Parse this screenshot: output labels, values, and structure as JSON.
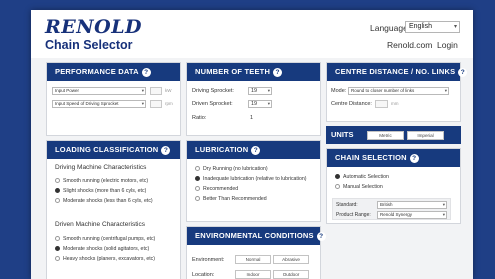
{
  "header": {
    "logo_text": "RENOLD",
    "app_title": "Chain Selector",
    "language_label": "Language",
    "language_value": "English",
    "site_link": "Renold.com",
    "login_link": "Login"
  },
  "performance": {
    "title": "PERFORMANCE DATA",
    "info_icon": "?",
    "input_power": {
      "value": "Input Power",
      "unit": "kW"
    },
    "input_speed": {
      "value": "Input Speed of Driving Sprocket",
      "unit": "rpm"
    }
  },
  "teeth": {
    "title": "NUMBER OF TEETH",
    "info_icon": "?",
    "driving_label": "Driving Sprocket:",
    "driving_value": "19",
    "driven_label": "Driven Sprocket:",
    "driven_value": "19",
    "ratio_label": "Ratio:",
    "ratio_value": "1"
  },
  "centre": {
    "title": "CENTRE DISTANCE / NO. LINKS",
    "info_icon": "?",
    "mode_label": "Mode:",
    "mode_value": "Round to closer number of links",
    "distance_label": "Centre Distance:",
    "distance_unit": "mm"
  },
  "units": {
    "title": "UNITS",
    "metric": "Metric",
    "imperial": "Imperial"
  },
  "loading": {
    "title": "LOADING CLASSIFICATION",
    "info_icon": "?",
    "driving_heading": "Driving Machine Characteristics",
    "driving_options": [
      "Smooth running (electric motors, etc)",
      "Slight shocks (more than 6 cyls, etc)",
      "Moderate shocks (less than 6 cyls, etc)"
    ],
    "driving_selected": 1,
    "driven_heading": "Driven Machine Characteristics",
    "driven_options": [
      "Smooth running (centrifugal pumps, etc)",
      "Moderate shocks (solid agitators, etc)",
      "Heavy shocks (planers, excavators, etc)"
    ],
    "driven_selected": 1
  },
  "lubrication": {
    "title": "LUBRICATION",
    "info_icon": "?",
    "options": [
      "Dry Running (no lubrication)",
      "Inadequate lubrication (relative to lubrication)",
      "Recommended",
      "Better Than Recommended"
    ],
    "selected": 1
  },
  "environment": {
    "title": "ENVIRONMENTAL CONDITIONS",
    "info_icon": "?",
    "environment_label": "Environment:",
    "environment_options": [
      "Normal",
      "Abrasive"
    ],
    "location_label": "Location:",
    "location_options": [
      "Indoor",
      "Outdoor"
    ]
  },
  "chain_selection": {
    "title": "CHAIN SELECTION",
    "info_icon": "?",
    "options": [
      "Automatic Selection",
      "Manual Selection"
    ],
    "selected": 0,
    "standard_label": "Standard:",
    "standard_value": "British",
    "product_label": "Product Range:",
    "product_value": "Renold Synergy"
  },
  "colors": {
    "background": "#1f3f86",
    "panel_header": "#173a7e",
    "brand": "#17317a"
  }
}
